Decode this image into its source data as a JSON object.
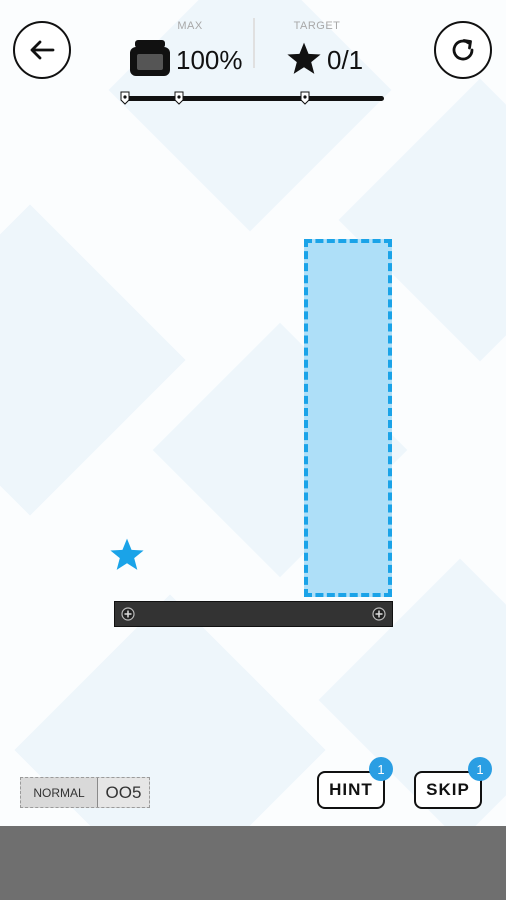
{
  "header": {
    "back_icon": "arrow-left-icon",
    "restart_icon": "restart-icon",
    "max_label": "MAX",
    "ink_value": "100%",
    "target_label": "TARGET",
    "target_value": "0/1",
    "ink_progress": 1.0
  },
  "level": {
    "star_color": "#1aa3e8",
    "ink_zone_color": "#aedff8",
    "platform_color": "#333333"
  },
  "footer": {
    "mode_label": "NORMAL",
    "level_number": "OO5",
    "hint_label": "HINT",
    "hint_count": "1",
    "skip_label": "SKIP",
    "skip_count": "1"
  }
}
